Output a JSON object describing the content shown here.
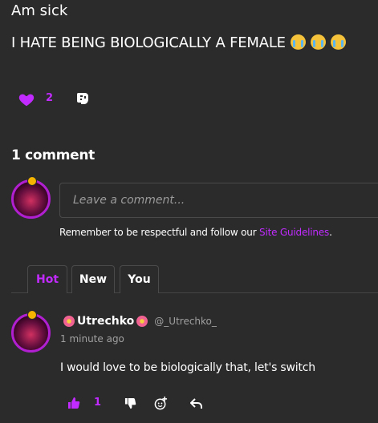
{
  "post": {
    "title": "Am sick",
    "body": "I HATE BEING BIOLOGICALLY A FEMALE",
    "emoji_icons": [
      "loudly-crying-face-icon",
      "loudly-crying-face-icon",
      "loudly-crying-face-icon"
    ],
    "like_count": "2"
  },
  "comments": {
    "heading": "1 comment",
    "input_placeholder": "Leave a comment...",
    "guidelines_prefix": "Remember to be respectful and follow our ",
    "guidelines_link": "Site Guidelines",
    "guidelines_suffix": ".",
    "tabs": [
      {
        "label": "Hot",
        "active": true
      },
      {
        "label": "New",
        "active": false
      },
      {
        "label": "You",
        "active": false
      }
    ],
    "items": [
      {
        "author": "Utrechko",
        "handle": "@_Utrechko_",
        "timestamp": "1 minute ago",
        "text": "I would love to be biologically that, let's switch",
        "like_count": "1"
      }
    ]
  },
  "colors": {
    "background": "#2b2b2b",
    "accent": "#c12bff",
    "text": "#ffffff",
    "muted": "#a0a0a0",
    "border": "#4a4a4a"
  }
}
